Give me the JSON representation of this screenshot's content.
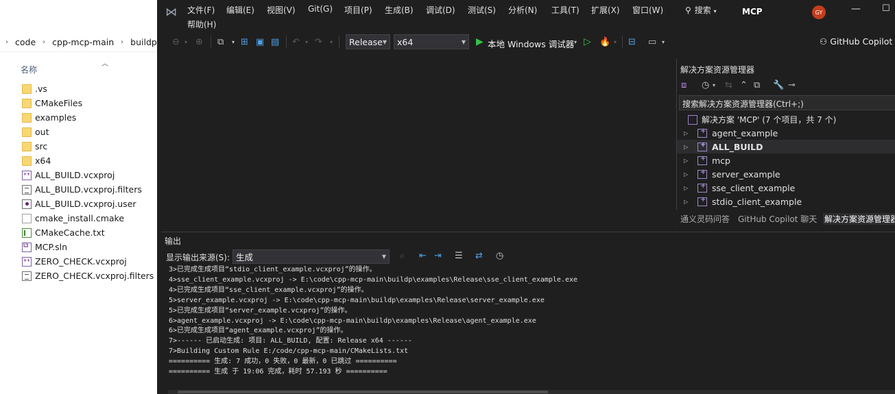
{
  "explorer": {
    "breadcrumb": [
      "code",
      "cpp-mcp-main",
      "buildp"
    ],
    "column_name": "名称",
    "files": [
      {
        "name": ".vs",
        "type": "folder"
      },
      {
        "name": "CMakeFiles",
        "type": "folder"
      },
      {
        "name": "examples",
        "type": "folder"
      },
      {
        "name": "out",
        "type": "folder"
      },
      {
        "name": "src",
        "type": "folder"
      },
      {
        "name": "x64",
        "type": "folder"
      },
      {
        "name": "ALL_BUILD.vcxproj",
        "type": "vcx"
      },
      {
        "name": "ALL_BUILD.vcxproj.filters",
        "type": "filt"
      },
      {
        "name": "ALL_BUILD.vcxproj.user",
        "type": "user"
      },
      {
        "name": "cmake_install.cmake",
        "type": "doc"
      },
      {
        "name": "CMakeCache.txt",
        "type": "txt"
      },
      {
        "name": "MCP.sln",
        "type": "sln"
      },
      {
        "name": "ZERO_CHECK.vcxproj",
        "type": "vcx"
      },
      {
        "name": "ZERO_CHECK.vcxproj.filters",
        "type": "filt"
      }
    ]
  },
  "menu": {
    "items": [
      "文件(F)",
      "编辑(E)",
      "视图(V)",
      "Git(G)",
      "项目(P)",
      "生成(B)",
      "调试(D)",
      "测试(S)",
      "分析(N)",
      "工具(T)",
      "扩展(X)",
      "窗口(W)"
    ],
    "help": "帮助(H)",
    "search": "搜索",
    "app_title": "MCP",
    "avatar": "GY"
  },
  "toolbar": {
    "config": "Release",
    "platform": "x64",
    "run": "本地 Windows 调试器",
    "copilot": "GitHub Copilot"
  },
  "solution_explorer": {
    "title": "解决方案资源管理器",
    "search_placeholder": "搜索解决方案资源管理器(Ctrl+;)",
    "root": "解决方案 'MCP' (7 个项目，共 7 个)",
    "projects": [
      "agent_example",
      "ALL_BUILD",
      "mcp",
      "server_example",
      "sse_client_example",
      "stdio_client_example"
    ],
    "tabs": [
      "通义灵码问答",
      "GitHub Copilot 聊天",
      "解决方案资源管理器"
    ]
  },
  "output": {
    "title": "输出",
    "source_label": "显示输出来源(S):",
    "source_value": "生成",
    "lines": [
      "3>已完成生成项目“stdio_client_example.vcxproj”的操作。",
      "4>sse_client_example.vcxproj -> E:\\code\\cpp-mcp-main\\buildp\\examples\\Release\\sse_client_example.exe",
      "4>已完成生成项目“sse_client_example.vcxproj”的操作。",
      "5>server_example.vcxproj -> E:\\code\\cpp-mcp-main\\buildp\\examples\\Release\\server_example.exe",
      "5>已完成生成项目“server_example.vcxproj”的操作。",
      "6>agent_example.vcxproj -> E:\\code\\cpp-mcp-main\\buildp\\examples\\Release\\agent_example.exe",
      "6>已完成生成项目“agent_example.vcxproj”的操作。",
      "7>------ 已启动生成: 项目: ALL_BUILD, 配置: Release x64 ------",
      "7>Building Custom Rule E:/code/cpp-mcp-main/CMakeLists.txt",
      "========== 生成: 7 成功，0 失败，0 最新，0 已跳过 ==========",
      "========== 生成 于 19:06 完成，耗时 57.193 秒 =========="
    ]
  }
}
